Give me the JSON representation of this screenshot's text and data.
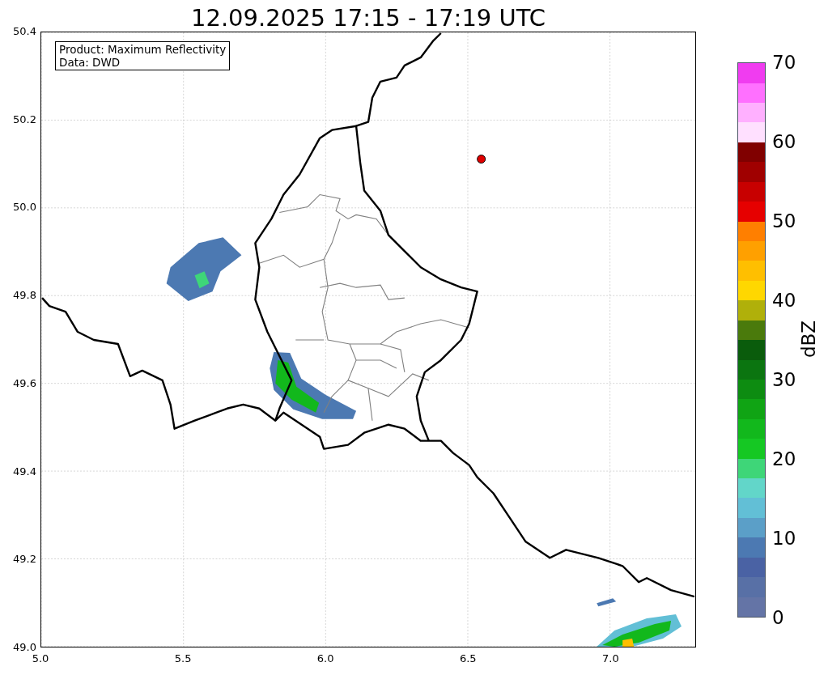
{
  "title": "12.09.2025 17:15 - 17:19 UTC",
  "map": {
    "info_box": [
      "Product: Maximum Reflectivity",
      "Data: DWD"
    ],
    "x_ticks": [
      "5.0",
      "5.5",
      "6.0",
      "6.5",
      "7.0"
    ],
    "y_ticks": [
      "50.4",
      "50.2",
      "50.0",
      "49.8",
      "49.6",
      "49.4",
      "49.2",
      "49.0"
    ]
  },
  "colorbar": {
    "label": "dBZ",
    "ticks": [
      "70",
      "60",
      "50",
      "40",
      "30",
      "20",
      "10",
      "0"
    ],
    "bands": [
      {
        "color": "#6474a6"
      },
      {
        "color": "#5870a6"
      },
      {
        "color": "#4a62a4"
      },
      {
        "color": "#4c79b2"
      },
      {
        "color": "#5b9fc8"
      },
      {
        "color": "#62bfd6"
      },
      {
        "color": "#62d6c9"
      },
      {
        "color": "#3ed678"
      },
      {
        "color": "#15c823"
      },
      {
        "color": "#12b81c"
      },
      {
        "color": "#10a414"
      },
      {
        "color": "#0d8c11"
      },
      {
        "color": "#0b7510"
      },
      {
        "color": "#0a5c0c"
      },
      {
        "color": "#4a7a0c"
      },
      {
        "color": "#b0b00a"
      },
      {
        "color": "#ffd700"
      },
      {
        "color": "#ffbf00"
      },
      {
        "color": "#ffa000"
      },
      {
        "color": "#ff7f00"
      },
      {
        "color": "#e60000"
      },
      {
        "color": "#c80000"
      },
      {
        "color": "#a00000"
      },
      {
        "color": "#800000"
      },
      {
        "color": "#ffe0ff"
      },
      {
        "color": "#ffb0ff"
      },
      {
        "color": "#ff70ff"
      },
      {
        "color": "#f03cf0"
      }
    ]
  }
}
